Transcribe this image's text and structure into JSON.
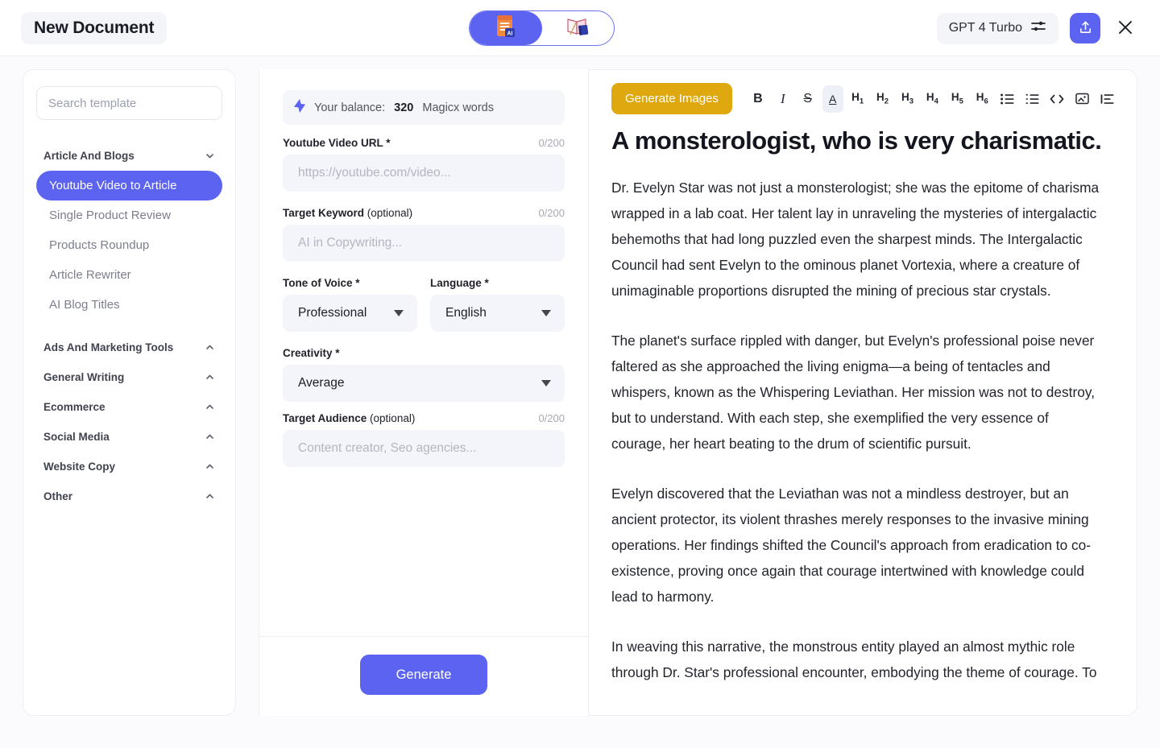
{
  "header": {
    "document_title": "New Document",
    "mode_toggle": {
      "options": [
        {
          "icon": "ai-document-icon",
          "active": true
        },
        {
          "icon": "open-book-icon",
          "active": false
        }
      ]
    },
    "model_selector": {
      "label": "GPT 4 Turbo",
      "icon": "sliders-icon"
    },
    "share_button": {
      "icon": "share-upload-icon"
    },
    "close_button": {
      "icon": "close-icon"
    }
  },
  "sidebar": {
    "search": {
      "placeholder": "Search template",
      "value": "",
      "icon": "search-icon"
    },
    "groups": [
      {
        "label": "Article And Blogs",
        "expanded": true,
        "chevron": "chevron-down-icon",
        "items": [
          {
            "label": "Youtube Video to Article",
            "active": true
          },
          {
            "label": "Single Product Review",
            "active": false
          },
          {
            "label": "Products Roundup",
            "active": false
          },
          {
            "label": "Article Rewriter",
            "active": false
          },
          {
            "label": "AI Blog Titles",
            "active": false
          }
        ]
      },
      {
        "label": "Ads And Marketing Tools",
        "expanded": false,
        "chevron": "chevron-up-icon",
        "items": []
      },
      {
        "label": "General Writing",
        "expanded": false,
        "chevron": "chevron-up-icon",
        "items": []
      },
      {
        "label": "Ecommerce",
        "expanded": false,
        "chevron": "chevron-up-icon",
        "items": []
      },
      {
        "label": "Social Media",
        "expanded": false,
        "chevron": "chevron-up-icon",
        "items": []
      },
      {
        "label": "Website Copy",
        "expanded": false,
        "chevron": "chevron-up-icon",
        "items": []
      },
      {
        "label": "Other",
        "expanded": false,
        "chevron": "chevron-up-icon",
        "items": []
      }
    ]
  },
  "form": {
    "balance": {
      "icon": "lightning-bolt-icon",
      "prefix": "Your balance:",
      "amount": "320",
      "suffix": "Magicx words"
    },
    "fields": {
      "youtube_url": {
        "label": "Youtube Video URL",
        "required_mark": "*",
        "counter": "0/200",
        "placeholder": "https://youtube.com/video...",
        "value": ""
      },
      "target_keyword": {
        "label": "Target Keyword",
        "optional_mark": "(optional)",
        "counter": "0/200",
        "placeholder": "AI in Copywriting...",
        "value": ""
      },
      "tone_of_voice": {
        "label": "Tone of Voice",
        "required_mark": "*",
        "value": "Professional",
        "caret": "chevron-down-icon"
      },
      "language": {
        "label": "Language",
        "required_mark": "*",
        "value": "English",
        "caret": "chevron-down-icon"
      },
      "creativity": {
        "label": "Creativity",
        "required_mark": "*",
        "value": "Average",
        "caret": "chevron-down-icon"
      },
      "target_audience": {
        "label": "Target Audience",
        "optional_mark": "(optional)",
        "counter": "0/200",
        "placeholder": "Content creator, Seo agencies...",
        "value": ""
      }
    },
    "generate_button": "Generate"
  },
  "editor": {
    "toolbar": {
      "generate_images": "Generate Images",
      "buttons": [
        {
          "name": "bold-icon",
          "label": "B",
          "active": false
        },
        {
          "name": "italic-icon",
          "label": "I",
          "active": false
        },
        {
          "name": "strikethrough-icon",
          "label": "S",
          "active": false
        },
        {
          "name": "text-color-icon",
          "label": "A",
          "active": true
        },
        {
          "name": "heading-1-icon",
          "label": "H",
          "sub": "1",
          "active": false
        },
        {
          "name": "heading-2-icon",
          "label": "H",
          "sub": "2",
          "active": false
        },
        {
          "name": "heading-3-icon",
          "label": "H",
          "sub": "3",
          "active": false
        },
        {
          "name": "heading-4-icon",
          "label": "H",
          "sub": "4",
          "active": false
        },
        {
          "name": "heading-5-icon",
          "label": "H",
          "sub": "5",
          "active": false
        },
        {
          "name": "heading-6-icon",
          "label": "H",
          "sub": "6",
          "active": false
        },
        {
          "name": "bullet-list-icon",
          "label": "",
          "active": false
        },
        {
          "name": "numbered-list-icon",
          "label": "",
          "active": false
        },
        {
          "name": "code-block-icon",
          "label": "",
          "active": false
        },
        {
          "name": "insert-image-icon",
          "label": "",
          "active": false
        },
        {
          "name": "align-indent-icon",
          "label": "",
          "active": false
        }
      ]
    },
    "document": {
      "title": "A monsterologist, who is very charismatic.",
      "paragraphs": [
        "Dr. Evelyn Star was not just a monsterologist; she was the epitome of charisma wrapped in a lab coat. Her talent lay in unraveling the mysteries of intergalactic behemoths that had long puzzled even the sharpest minds. The Intergalactic Council had sent Evelyn to the ominous planet Vortexia, where a creature of unimaginable proportions disrupted the mining of precious star crystals.",
        "The planet's surface rippled with danger, but Evelyn's professional poise never faltered as she approached the living enigma—a being of tentacles and whispers, known as the Whispering Leviathan. Her mission was not to destroy, but to understand. With each step, she exemplified the very essence of courage, her heart beating to the drum of scientific pursuit.",
        "Evelyn discovered that the Leviathan was not a mindless destroyer, but an ancient protector, its violent thrashes merely responses to the invasive mining operations. Her findings shifted the Council's approach from eradication to co-existence, proving once again that courage intertwined with knowledge could lead to harmony.",
        "In weaving this narrative, the monstrous entity played an almost mythic role through Dr. Star's professional encounter, embodying the theme of courage. To"
      ]
    }
  },
  "colors": {
    "accent": "#5b63f0",
    "gold": "#dfa80f",
    "input_bg": "#f4f5fa",
    "text_primary": "#1b1d26",
    "text_muted": "#7c808e"
  }
}
